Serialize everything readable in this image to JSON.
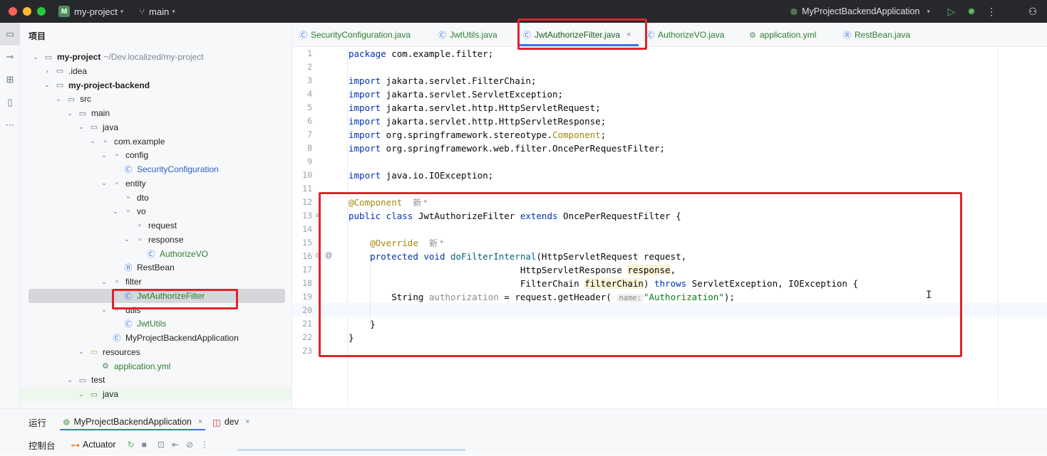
{
  "window": {
    "project_name": "my-project",
    "project_badge": "M",
    "branch": "main",
    "run_config": "MyProjectBackendApplication",
    "traffic_colors": [
      "#ff5f57",
      "#febc2e",
      "#28c840"
    ]
  },
  "project_panel": {
    "title": "项目",
    "tree": [
      {
        "label": "my-project",
        "path": "~/Dev.localized/my-project",
        "depth": 0,
        "chevron": "open",
        "icon": "module-folder-icon",
        "style": "bold"
      },
      {
        "label": ".idea",
        "depth": 1,
        "chevron": "closed",
        "icon": "folder-icon"
      },
      {
        "label": "my-project-backend",
        "depth": 1,
        "chevron": "open",
        "icon": "module-folder-icon",
        "style": "bold"
      },
      {
        "label": "src",
        "depth": 2,
        "chevron": "open",
        "icon": "folder-icon"
      },
      {
        "label": "main",
        "depth": 3,
        "chevron": "open",
        "icon": "folder-icon"
      },
      {
        "label": "java",
        "depth": 4,
        "chevron": "open",
        "icon": "source-folder-icon"
      },
      {
        "label": "com.example",
        "depth": 5,
        "chevron": "open",
        "icon": "package-icon"
      },
      {
        "label": "config",
        "depth": 6,
        "chevron": "open",
        "icon": "package-icon"
      },
      {
        "label": "SecurityConfiguration",
        "depth": 7,
        "chevron": "",
        "icon": "class-icon",
        "style": "blue"
      },
      {
        "label": "entity",
        "depth": 6,
        "chevron": "open",
        "icon": "package-icon"
      },
      {
        "label": "dto",
        "depth": 7,
        "chevron": "",
        "icon": "package-icon"
      },
      {
        "label": "vo",
        "depth": 7,
        "chevron": "open",
        "icon": "package-icon"
      },
      {
        "label": "request",
        "depth": 8,
        "chevron": "",
        "icon": "package-icon"
      },
      {
        "label": "response",
        "depth": 8,
        "chevron": "open",
        "icon": "package-icon"
      },
      {
        "label": "AuthorizeVO",
        "depth": 9,
        "chevron": "",
        "icon": "class-icon",
        "style": "green"
      },
      {
        "label": "RestBean",
        "depth": 7,
        "chevron": "",
        "icon": "record-icon"
      },
      {
        "label": "filter",
        "depth": 6,
        "chevron": "open",
        "icon": "package-icon"
      },
      {
        "label": "JwtAuthorizeFilter",
        "depth": 7,
        "chevron": "",
        "icon": "class-icon",
        "style": "green",
        "selected": true
      },
      {
        "label": "utils",
        "depth": 6,
        "chevron": "open",
        "icon": "package-icon"
      },
      {
        "label": "JwtUtils",
        "depth": 7,
        "chevron": "",
        "icon": "class-icon",
        "style": "green"
      },
      {
        "label": "MyProjectBackendApplication",
        "depth": 6,
        "chevron": "",
        "icon": "spring-class-icon"
      },
      {
        "label": "resources",
        "depth": 4,
        "chevron": "open",
        "icon": "resources-folder-icon"
      },
      {
        "label": "application.yml",
        "depth": 5,
        "chevron": "",
        "icon": "yml-icon",
        "style": "green"
      },
      {
        "label": "test",
        "depth": 3,
        "chevron": "open",
        "icon": "folder-icon"
      },
      {
        "label": "java",
        "depth": 4,
        "chevron": "open",
        "icon": "test-folder-icon",
        "test": true
      }
    ]
  },
  "tabs": [
    {
      "label": "SecurityConfiguration.java",
      "icon": "class-icon"
    },
    {
      "label": "JwtUtils.java",
      "icon": "class-icon"
    },
    {
      "label": "JwtAuthorizeFilter.java",
      "icon": "class-icon",
      "active": true,
      "close": "×"
    },
    {
      "label": "AuthorizeVO.java",
      "icon": "class-icon"
    },
    {
      "label": "application.yml",
      "icon": "yml-icon"
    },
    {
      "label": "RestBean.java",
      "icon": "record-icon"
    }
  ],
  "editor": {
    "line_numbers": [
      "1",
      "2",
      "3",
      "4",
      "5",
      "6",
      "7",
      "8",
      "9",
      "10",
      "11",
      "12",
      "13",
      "14",
      "15",
      "16",
      "17",
      "18",
      "19",
      "20",
      "21",
      "22",
      "23"
    ],
    "code": {
      "l1_kw": "package",
      "l1_rest": " com.example.filter;",
      "l3_kw": "import",
      "l3_rest": " jakarta.servlet.FilterChain;",
      "l4_kw": "import",
      "l4_rest": " jakarta.servlet.ServletException;",
      "l5_kw": "import",
      "l5_rest": " jakarta.servlet.http.HttpServletRequest;",
      "l6_kw": "import",
      "l6_rest": " jakarta.servlet.http.HttpServletResponse;",
      "l7_kw": "import",
      "l7_a": " org.springframework.stereotype.",
      "l7_ann": "Component",
      "l7_b": ";",
      "l8_kw": "import",
      "l8_rest": " org.springframework.web.filter.OncePerRequestFilter;",
      "l10_kw": "import",
      "l10_rest": " java.io.IOException;",
      "l12_ann": "@Component",
      "l12_cn": "新 *",
      "l13_kw1": "public class",
      "l13_a": " JwtAuthorizeFilter ",
      "l13_kw2": "extends",
      "l13_b": " OncePerRequestFilter {",
      "l15_ann": "@Override",
      "l15_cn": "新 *",
      "l16_kw": "protected void",
      "l16_method": " doFilterInternal",
      "l16_rest": "(HttpServletRequest request,",
      "l17_a": "HttpServletResponse ",
      "l17_hl": "response",
      "l17_b": ",",
      "l18_a": "FilterChain ",
      "l18_hl": "filterChain",
      "l18_b": ") ",
      "l18_kw": "throws",
      "l18_c": " ServletException, IOException {",
      "l19_a": "String ",
      "l19_var": "authorization",
      "l19_b": " = request.getHeader(",
      "l19_hint": "name:",
      "l19_str": "\"Authorization\"",
      "l19_c": ");",
      "l21": "}",
      "l22": "}"
    }
  },
  "bottom_panel": {
    "run_label": "运行",
    "run_tab": "MyProjectBackendApplication",
    "run_tab_close": "×",
    "dev_tab": "dev",
    "dev_tab_close": "×",
    "console_label": "控制台",
    "actuator_label": "Actuator"
  },
  "colors": {
    "accent": "#3574f0",
    "highlight_box": "#e0242c"
  }
}
